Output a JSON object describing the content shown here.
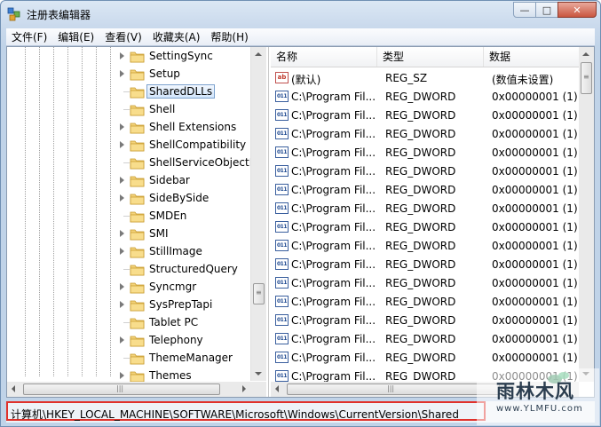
{
  "window": {
    "title": "注册表编辑器",
    "minimize_glyph": "—",
    "maximize_glyph": "□",
    "close_glyph": "✕"
  },
  "menu": [
    {
      "label": "文件(F)"
    },
    {
      "label": "编辑(E)"
    },
    {
      "label": "查看(V)"
    },
    {
      "label": "收藏夹(A)"
    },
    {
      "label": "帮助(H)"
    }
  ],
  "tree": {
    "items": [
      {
        "label": "SettingSync",
        "expandable": true,
        "selected": false
      },
      {
        "label": "Setup",
        "expandable": true,
        "selected": false
      },
      {
        "label": "SharedDLLs",
        "expandable": false,
        "selected": true
      },
      {
        "label": "Shell",
        "expandable": false,
        "selected": false
      },
      {
        "label": "Shell Extensions",
        "expandable": true,
        "selected": false
      },
      {
        "label": "ShellCompatibility",
        "expandable": true,
        "selected": false
      },
      {
        "label": "ShellServiceObjectI",
        "expandable": false,
        "selected": false
      },
      {
        "label": "Sidebar",
        "expandable": true,
        "selected": false
      },
      {
        "label": "SideBySide",
        "expandable": true,
        "selected": false
      },
      {
        "label": "SMDEn",
        "expandable": false,
        "selected": false
      },
      {
        "label": "SMI",
        "expandable": true,
        "selected": false
      },
      {
        "label": "StillImage",
        "expandable": true,
        "selected": false
      },
      {
        "label": "StructuredQuery",
        "expandable": false,
        "selected": false
      },
      {
        "label": "Syncmgr",
        "expandable": true,
        "selected": false
      },
      {
        "label": "SysPrepTapi",
        "expandable": true,
        "selected": false
      },
      {
        "label": "Tablet PC",
        "expandable": false,
        "selected": false
      },
      {
        "label": "Telephony",
        "expandable": true,
        "selected": false
      },
      {
        "label": "ThemeManager",
        "expandable": false,
        "selected": false
      },
      {
        "label": "Themes",
        "expandable": true,
        "selected": false
      }
    ]
  },
  "list": {
    "columns": [
      "名称",
      "类型",
      "数据"
    ],
    "rows": [
      {
        "icon": "ab",
        "name": "(默认)",
        "type": "REG_SZ",
        "data": "(数值未设置)"
      },
      {
        "icon": "011",
        "name": "C:\\Program Fil...",
        "type": "REG_DWORD",
        "data": "0x00000001 (1)"
      },
      {
        "icon": "011",
        "name": "C:\\Program Fil...",
        "type": "REG_DWORD",
        "data": "0x00000001 (1)"
      },
      {
        "icon": "011",
        "name": "C:\\Program Fil...",
        "type": "REG_DWORD",
        "data": "0x00000001 (1)"
      },
      {
        "icon": "011",
        "name": "C:\\Program Fil...",
        "type": "REG_DWORD",
        "data": "0x00000001 (1)"
      },
      {
        "icon": "011",
        "name": "C:\\Program Fil...",
        "type": "REG_DWORD",
        "data": "0x00000001 (1)"
      },
      {
        "icon": "011",
        "name": "C:\\Program Fil...",
        "type": "REG_DWORD",
        "data": "0x00000001 (1)"
      },
      {
        "icon": "011",
        "name": "C:\\Program Fil...",
        "type": "REG_DWORD",
        "data": "0x00000001 (1)"
      },
      {
        "icon": "011",
        "name": "C:\\Program Fil...",
        "type": "REG_DWORD",
        "data": "0x00000001 (1)"
      },
      {
        "icon": "011",
        "name": "C:\\Program Fil...",
        "type": "REG_DWORD",
        "data": "0x00000001 (1)"
      },
      {
        "icon": "011",
        "name": "C:\\Program Fil...",
        "type": "REG_DWORD",
        "data": "0x00000001 (1)"
      },
      {
        "icon": "011",
        "name": "C:\\Program Fil...",
        "type": "REG_DWORD",
        "data": "0x00000001 (1)"
      },
      {
        "icon": "011",
        "name": "C:\\Program Fil...",
        "type": "REG_DWORD",
        "data": "0x00000001 (1)"
      },
      {
        "icon": "011",
        "name": "C:\\Program Fil...",
        "type": "REG_DWORD",
        "data": "0x00000001 (1)"
      },
      {
        "icon": "011",
        "name": "C:\\Program Fil...",
        "type": "REG_DWORD",
        "data": "0x00000001 (1)"
      },
      {
        "icon": "011",
        "name": "C:\\Program Fil...",
        "type": "REG_DWORD",
        "data": "0x00000001 (1)"
      },
      {
        "icon": "011",
        "name": "C:\\Program Fil...",
        "type": "REG_DWORD",
        "data": "0x00000001 (1)"
      }
    ]
  },
  "status": {
    "path": "计算机\\HKEY_LOCAL_MACHINE\\SOFTWARE\\Microsoft\\Windows\\CurrentVersion\\Shared"
  },
  "watermark": {
    "brand": "雨林木风",
    "url": "www.YLMFU.com"
  },
  "colors": {
    "highlight_border": "#e0312b",
    "selection_border": "#7da2ce"
  }
}
